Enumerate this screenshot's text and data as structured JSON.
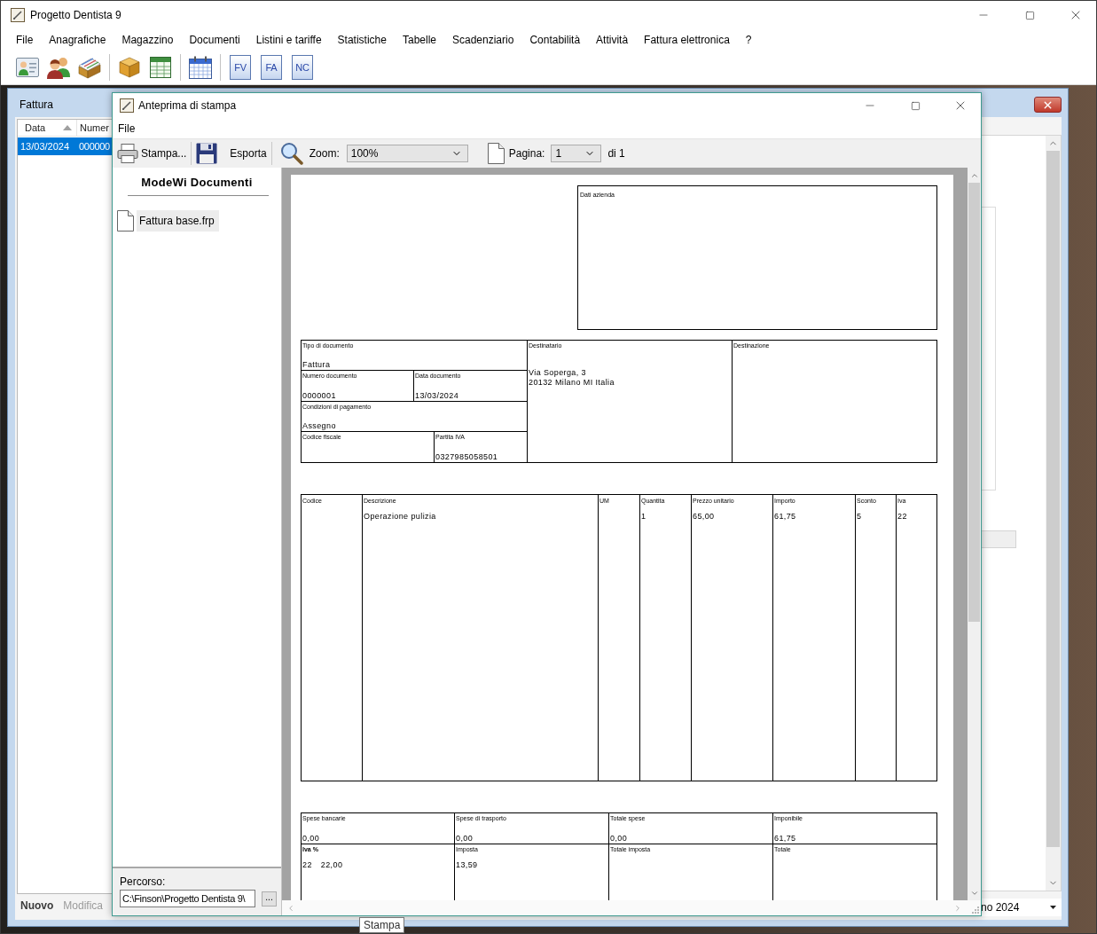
{
  "window": {
    "title": "Progetto Dentista 9"
  },
  "menu": [
    "File",
    "Anagrafiche",
    "Magazzino",
    "Documenti",
    "Listini e tariffe",
    "Statistiche",
    "Tabelle",
    "Scadenziario",
    "Contabilità",
    "Attività",
    "Fattura elettronica",
    "?"
  ],
  "toolbar": {
    "document_buttons": [
      "FV",
      "FA",
      "NC"
    ]
  },
  "invoice_window": {
    "title": "Fattura",
    "list": {
      "columns": [
        {
          "label": "Data",
          "sorted": true
        },
        {
          "label": "Numer"
        }
      ],
      "rows": [
        {
          "cells": [
            "13/03/2024",
            "000000"
          ],
          "selected": true
        }
      ]
    },
    "buttons": [
      {
        "label": "Nuovo",
        "disabled": false
      },
      {
        "label": "Modifica",
        "disabled": true
      }
    ],
    "period": {
      "value": "no 2024"
    }
  },
  "preview_dialog": {
    "title": "Anteprima di stampa",
    "menu": [
      "File"
    ],
    "toolbar": {
      "print": "Stampa...",
      "export": "Esporta",
      "zoom_label": "Zoom:",
      "zoom": "100%",
      "page_label": "Pagina:",
      "page": "1",
      "page_total": "di 1"
    },
    "templates": {
      "heading": "ModeWi Documenti",
      "items": [
        {
          "label": "Fattura base.frp",
          "selected": true
        }
      ],
      "path_label": "Percorso:",
      "path": "C:\\Finson\\Progetto Dentista 9\\",
      "browse": "..."
    },
    "document": {
      "company": {
        "label": "Dati azienda"
      },
      "header": {
        "document_type": {
          "label": "Tipo di documento",
          "value": "Fattura"
        },
        "number": {
          "label": "Numero documento",
          "value": "0000001"
        },
        "date": {
          "label": "Data documento",
          "value": "13/03/2024"
        },
        "payment": {
          "label": "Condizioni di pagamento",
          "value": "Assegno"
        },
        "tax_code": {
          "label": "Codice fiscale"
        },
        "vat_number": {
          "label": "Partita IVA",
          "value": "0327985058501"
        },
        "recipient": {
          "label": "Destinatario",
          "lines": [
            "Via Soperga, 3",
            "20132 Milano MI Italia"
          ]
        },
        "destination": {
          "label": "Destinazione"
        }
      },
      "items": {
        "columns": [
          "Codice",
          "Descrizione",
          "UM",
          "Quantita",
          "Prezzo unitario",
          "Importo",
          "Sconto",
          "Iva"
        ],
        "rows": [
          {
            "cells": [
              null,
              "Operazione pulizia",
              null,
              "1",
              "65,00",
              "61,75",
              "5",
              "22"
            ]
          }
        ]
      },
      "totals": [
        [
          {
            "label": "Spese bancarie",
            "values": [
              "0,00"
            ]
          },
          {
            "label": "Spese di trasporto",
            "values": [
              "0,00"
            ]
          },
          {
            "label": "Totale spese",
            "values": [
              "0,00"
            ]
          },
          {
            "label": "Imponibile",
            "values": [
              "61,75"
            ]
          }
        ],
        [
          {
            "label": "Iva %",
            "values": [
              "22",
              "22,00"
            ]
          },
          {
            "label": "Imposta",
            "values": [
              "13,59"
            ]
          },
          {
            "label": "Totale imposta"
          },
          {
            "label": "Totale"
          }
        ]
      ]
    }
  },
  "tooltip": "Stampa"
}
